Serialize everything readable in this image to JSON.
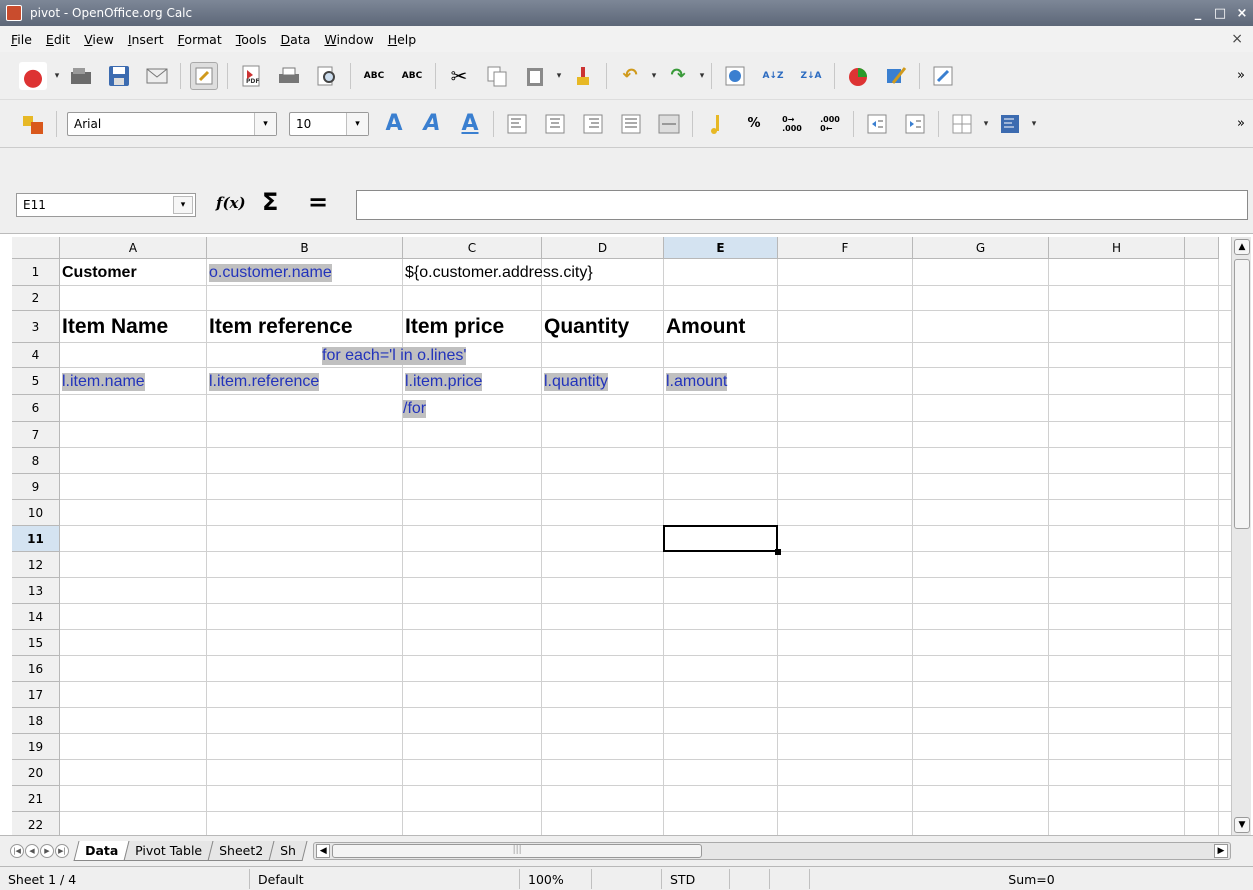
{
  "window": {
    "title": "pivot - OpenOffice.org Calc",
    "controls": [
      "_",
      "□",
      "×"
    ]
  },
  "menu": {
    "items": [
      "File",
      "Edit",
      "View",
      "Insert",
      "Format",
      "Tools",
      "Data",
      "Window",
      "Help"
    ],
    "close_label": "×"
  },
  "toolbar_standard": {
    "icons": [
      "new-document-icon",
      "open-icon",
      "save-icon",
      "email-icon",
      "edit-mode-icon",
      "export-pdf-icon",
      "print-icon",
      "page-preview-icon",
      "spellcheck-icon",
      "autospellcheck-icon",
      "cut-icon",
      "copy-icon",
      "paste-icon",
      "format-paintbrush-icon",
      "undo-icon",
      "redo-icon",
      "navigator-icon",
      "sort-ascending-icon",
      "sort-descending-icon",
      "chart-icon",
      "draw-functions-icon",
      "hyperlink-icon"
    ],
    "more": "»"
  },
  "toolbar_format": {
    "font_name": "Arial",
    "font_size": "10",
    "align_icons": [
      "bold-icon",
      "italic-icon",
      "underline-icon",
      "align-left-icon",
      "align-center-icon",
      "align-right-icon",
      "justify-icon",
      "merge-cells-icon",
      "currency-icon",
      "percent-icon",
      "add-decimal-icon",
      "delete-decimal-icon",
      "decrease-indent-icon",
      "increase-indent-icon",
      "borders-icon",
      "background-color-icon"
    ],
    "percent_label": "%",
    "more": "»"
  },
  "formula_bar": {
    "cell_ref": "E11",
    "fx_label": "f(x)",
    "sigma_label": "Σ",
    "equals_label": "=",
    "formula": ""
  },
  "sheet": {
    "columns": [
      {
        "label": "A"
      },
      {
        "label": "B"
      },
      {
        "label": "C"
      },
      {
        "label": "D"
      },
      {
        "label": "E"
      },
      {
        "label": "F"
      },
      {
        "label": "G"
      },
      {
        "label": "H"
      }
    ],
    "active_column": "E",
    "rows": [
      "1",
      "2",
      "3",
      "4",
      "5",
      "6",
      "7",
      "8",
      "9",
      "10",
      "11",
      "12",
      "13",
      "14",
      "15",
      "16",
      "17",
      "18",
      "19",
      "20",
      "21",
      "22"
    ],
    "active_row": "11",
    "cells": {
      "A1": "Customer",
      "B1": "o.customer.name",
      "C1": "${o.customer.address.city}",
      "A3": "Item Name",
      "B3": "Item reference",
      "C3": "Item price",
      "D3": "Quantity",
      "E3": "Amount",
      "A4": "for each='l in o.lines'",
      "A5": "l.item.name",
      "B5": "l.item.reference",
      "C5": "l.item.price",
      "D5": "l.quantity",
      "E5": "l.amount",
      "A6": "/for"
    },
    "selected_cell": "E11"
  },
  "tabs": {
    "items": [
      "Data",
      "Pivot Table",
      "Sheet2",
      "Sh"
    ],
    "active": "Data"
  },
  "status": {
    "sheet": "Sheet 1 / 4",
    "page_style": "Default",
    "zoom": "100%",
    "mode": "STD",
    "sum": "Sum=0"
  },
  "colors": {
    "template_text": "#2233bb",
    "template_highlight": "#c0c0c0",
    "active_header": "#d4e3f1"
  }
}
